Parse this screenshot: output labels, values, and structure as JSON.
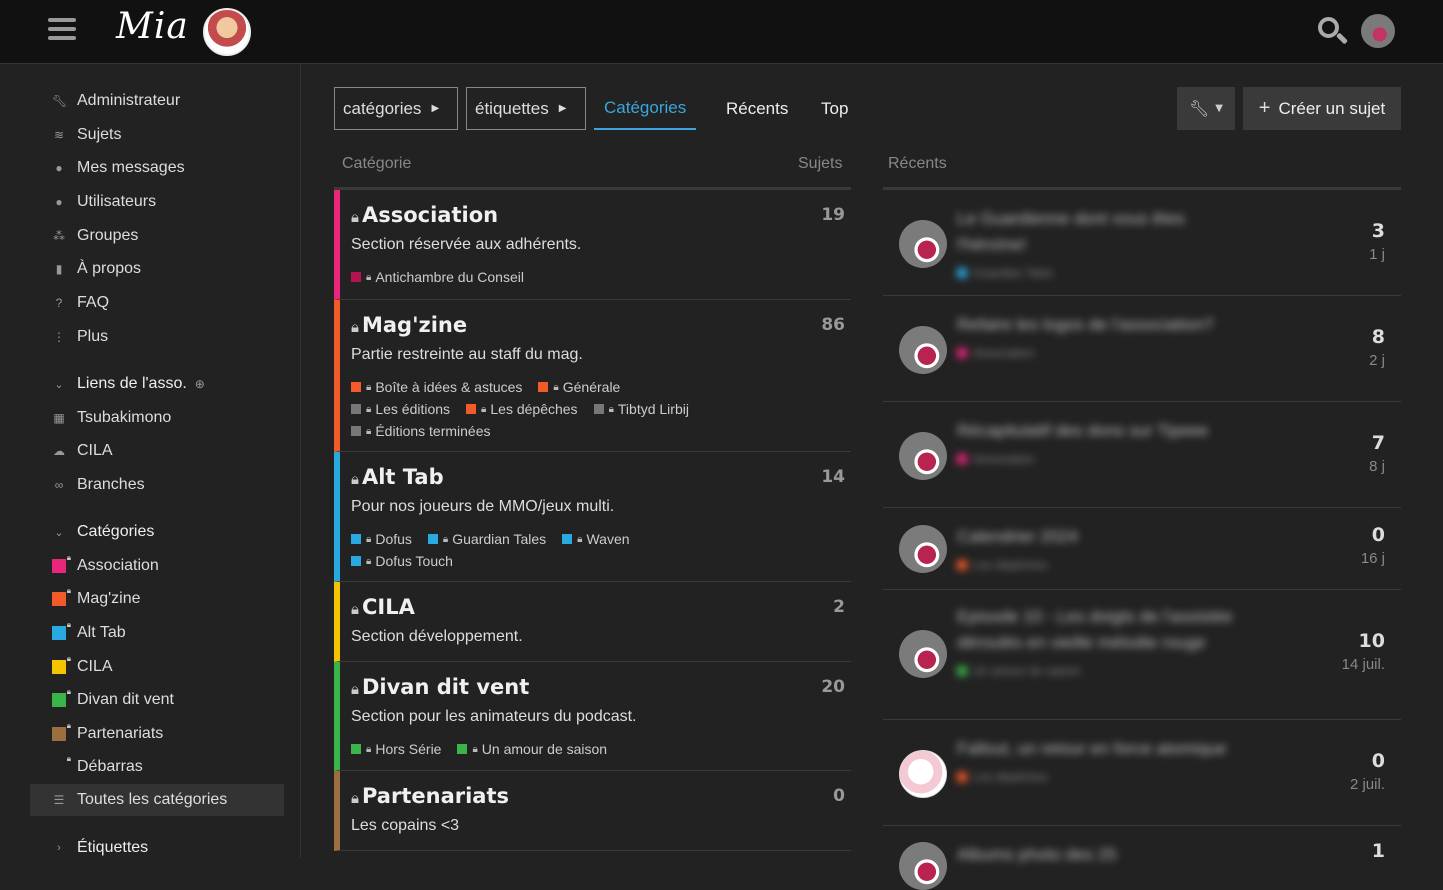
{
  "header": {
    "logo_text": "Mia"
  },
  "sidebar": {
    "items": [
      {
        "label": "Administrateur",
        "icon": "wrench-icon"
      },
      {
        "label": "Sujets",
        "icon": "layers-icon"
      },
      {
        "label": "Mes messages",
        "icon": "user-icon"
      },
      {
        "label": "Utilisateurs",
        "icon": "user-icon"
      },
      {
        "label": "Groupes",
        "icon": "users-icon"
      },
      {
        "label": "À propos",
        "icon": "bookmark-icon"
      },
      {
        "label": "FAQ",
        "icon": "question-icon"
      },
      {
        "label": "Plus",
        "icon": "ellipsis-icon"
      }
    ],
    "links_section": {
      "label": "Liens de l'asso."
    },
    "links": [
      {
        "label": "Tsubakimono",
        "icon": "boxes-icon"
      },
      {
        "label": "CILA",
        "icon": "cloud-icon"
      },
      {
        "label": "Branches",
        "icon": "link-icon"
      }
    ],
    "categories_section": {
      "label": "Catégories"
    },
    "categories": [
      {
        "label": "Association",
        "color": "#e9267c"
      },
      {
        "label": "Mag'zine",
        "color": "#f15a29"
      },
      {
        "label": "Alt Tab",
        "color": "#2aa9e0"
      },
      {
        "label": "CILA",
        "color": "#f5c400"
      },
      {
        "label": "Divan dit vent",
        "color": "#3ab54a"
      },
      {
        "label": "Partenariats",
        "color": "#9e6f3e"
      },
      {
        "label": "Débarras",
        "color": ""
      }
    ],
    "all_categories": "Toutes les catégories",
    "tags_section": {
      "label": "Étiquettes"
    }
  },
  "nav": {
    "categories_dropdown": "catégories",
    "tags_dropdown": "étiquettes",
    "tabs": [
      "Catégories",
      "Récents",
      "Top"
    ],
    "create_topic": "Créer un sujet"
  },
  "table": {
    "col_category": "Catégorie",
    "col_topics": "Sujets",
    "col_recent": "Récents"
  },
  "categories": [
    {
      "name": "Association",
      "count": "19",
      "desc": "Section réservée aux adhérents.",
      "color": "#e9267c",
      "subs": [
        [
          {
            "name": "Antichambre du Conseil",
            "color": "#b3134f"
          }
        ]
      ]
    },
    {
      "name": "Mag'zine",
      "count": "86",
      "desc": "Partie restreinte au staff du mag.",
      "color": "#f15a29",
      "subs": [
        [
          {
            "name": "Boîte à idées & astuces",
            "color": "#f15a29"
          },
          {
            "name": "Générale",
            "color": "#f15a29"
          }
        ],
        [
          {
            "name": "Les éditions",
            "color": "#777777"
          },
          {
            "name": "Les dépêches",
            "color": "#f15a29"
          },
          {
            "name": "Tibtyd Lirbij",
            "color": "#777777"
          }
        ],
        [
          {
            "name": "Éditions terminées",
            "color": "#777777"
          }
        ]
      ]
    },
    {
      "name": "Alt Tab",
      "count": "14",
      "desc": "Pour nos joueurs de MMO/jeux multi.",
      "color": "#2aa9e0",
      "subs": [
        [
          {
            "name": "Dofus",
            "color": "#2aa9e0"
          },
          {
            "name": "Guardian Tales",
            "color": "#2aa9e0"
          },
          {
            "name": "Waven",
            "color": "#2aa9e0"
          }
        ],
        [
          {
            "name": "Dofus Touch",
            "color": "#2aa9e0"
          }
        ]
      ]
    },
    {
      "name": "CILA",
      "count": "2",
      "desc": "Section développement.",
      "color": "#f5c400",
      "subs": []
    },
    {
      "name": "Divan dit vent",
      "count": "20",
      "desc": "Section pour les animateurs du podcast.",
      "color": "#3ab54a",
      "subs": [
        [
          {
            "name": "Hors Série",
            "color": "#3ab54a"
          },
          {
            "name": "Un amour de saison",
            "color": "#3ab54a"
          }
        ]
      ]
    },
    {
      "name": "Partenariats",
      "count": "0",
      "desc": "Les copains <3",
      "color": "#9e6f3e",
      "subs": []
    }
  ],
  "topics": [
    {
      "title": "Le Guardienne dont vous êtes l'héroïne!",
      "cat": "Guardian Tales",
      "cat_color": "#2aa9e0",
      "replies": "3",
      "age": "1 j"
    },
    {
      "title": "Refaire les logos de l'association?",
      "cat": "Association",
      "cat_color": "#e9267c",
      "replies": "8",
      "age": "2 j"
    },
    {
      "title": "Récapitulatif des dons sur Tipeee",
      "cat": "Association",
      "cat_color": "#e9267c",
      "replies": "7",
      "age": "8 j"
    },
    {
      "title": "Calendrier 2024",
      "cat": "Les dépêches",
      "cat_color": "#f15a29",
      "replies": "0",
      "age": "16 j"
    },
    {
      "title": "Episode 10 - Les doigts de l'assistée déroulés en vieille mélodie rouge",
      "cat": "Un amour de saison",
      "cat_color": "#3ab54a",
      "replies": "10",
      "age": "14 juil."
    },
    {
      "title": "Fallout, un retour en force atomique",
      "cat": "Les dépêches",
      "cat_color": "#f15a29",
      "replies": "0",
      "age": "2 juil."
    },
    {
      "title": "Albums photo des 25",
      "cat": "",
      "cat_color": "#777777",
      "replies": "1",
      "age": ""
    }
  ]
}
